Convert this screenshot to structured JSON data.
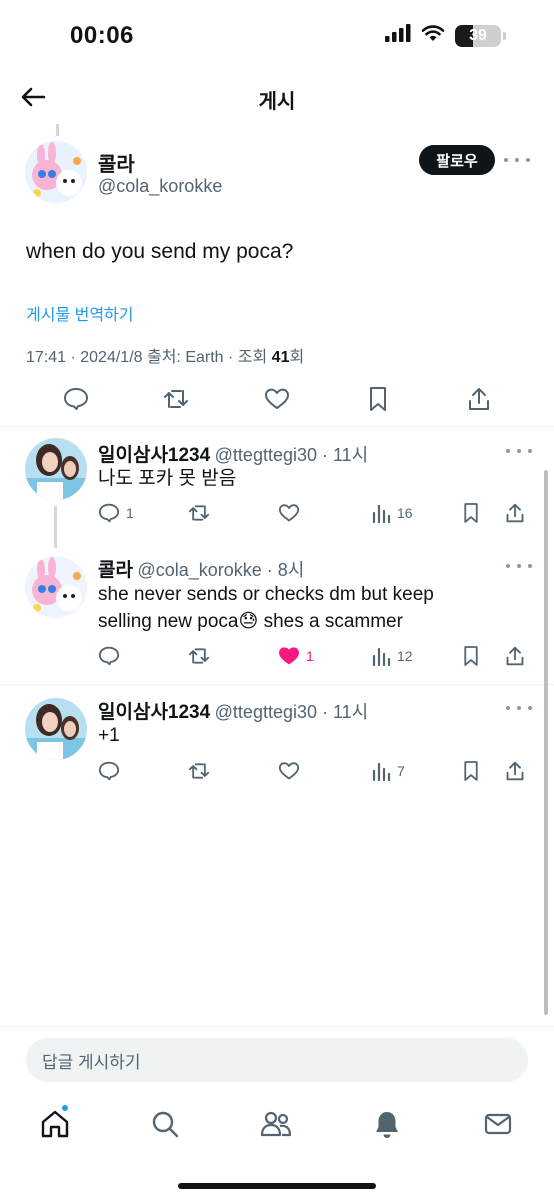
{
  "status_bar": {
    "time": "00:06",
    "battery": "39"
  },
  "header": {
    "title": "게시"
  },
  "post": {
    "name": "콜라",
    "handle": "@cola_korokke",
    "follow_label": "팔로우",
    "text": "when do you send my poca?",
    "translate_label": "게시물 번역하기",
    "meta_prefix": "17:41 · 2024/1/8 출처: Earth · 조회 ",
    "views": "41",
    "meta_suffix": "회"
  },
  "replies": [
    {
      "name": "일이삼사1234",
      "handle_time": "@ttegttegi30 · 11시",
      "lines": [
        "나도 포카 못 받음"
      ],
      "reply_count": "1",
      "like_count": "",
      "view_count": "16",
      "liked": false
    },
    {
      "name": "콜라",
      "handle_time": "@cola_korokke · 8시",
      "lines": [
        "she never sends or checks dm but keep",
        "selling new poca😓  shes a scammer"
      ],
      "reply_count": "",
      "like_count": "1",
      "view_count": "12",
      "liked": true
    },
    {
      "name": "일이삼사1234",
      "handle_time": "@ttegttegi30 · 11시",
      "lines": [
        "+1"
      ],
      "reply_count": "",
      "like_count": "",
      "view_count": "7",
      "liked": false
    }
  ],
  "composer": {
    "placeholder": "답글 게시하기"
  },
  "tabs": [
    "home-icon",
    "search-icon",
    "communities-icon",
    "notifications-icon",
    "messages-icon"
  ],
  "colors": {
    "accent": "#1d9bf0",
    "like": "#f91880",
    "text": "#0f1419",
    "muted": "#536471"
  }
}
